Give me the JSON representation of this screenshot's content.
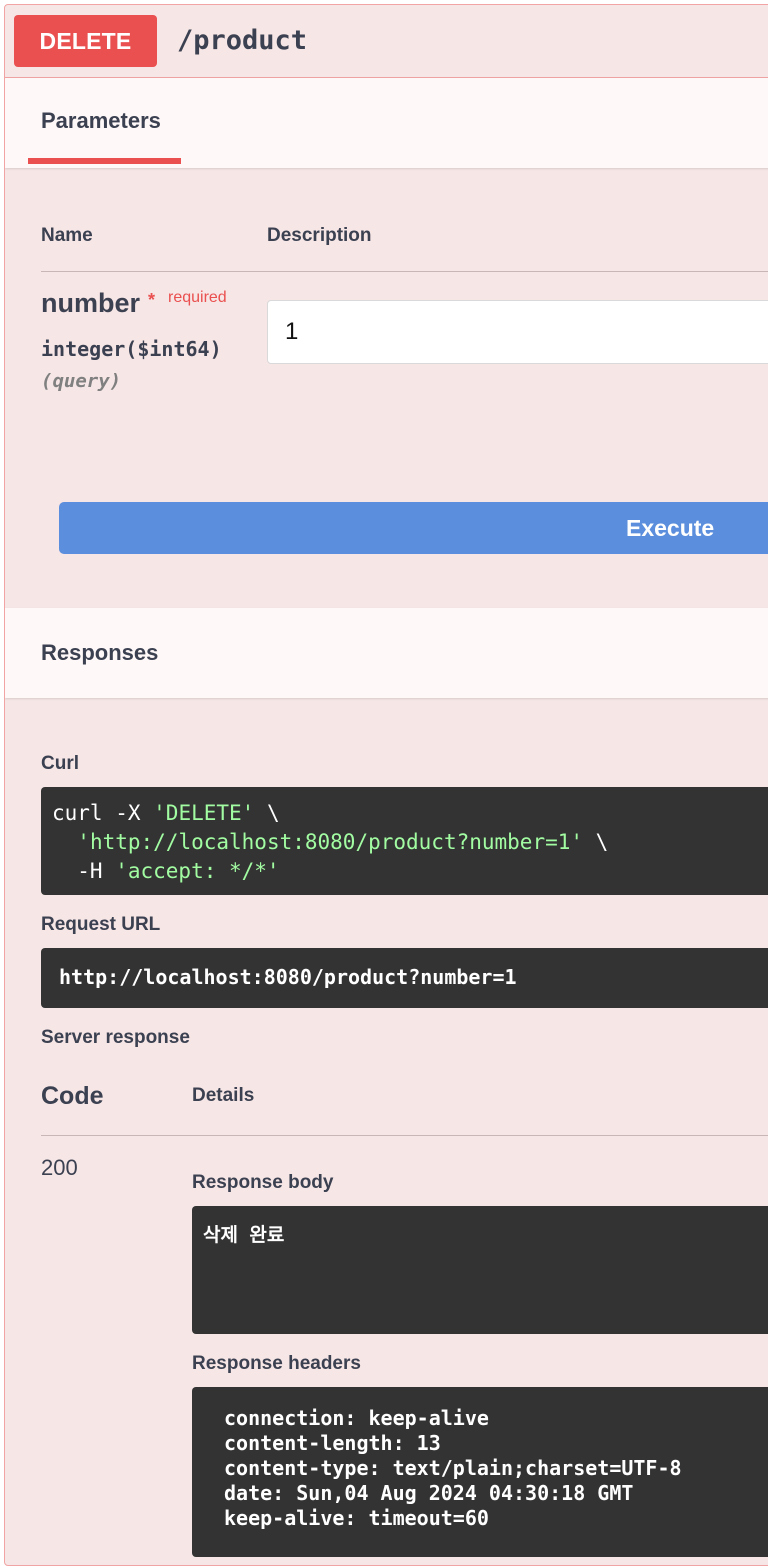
{
  "summary": {
    "method": "DELETE",
    "path": "/product"
  },
  "parameters": {
    "title": "Parameters",
    "col_name": "Name",
    "col_description": "Description",
    "param": {
      "name": "number",
      "required_mark": "*",
      "required_label": "required",
      "type": "integer($int64)",
      "location": "(query)",
      "value": "1"
    },
    "execute_label": "Execute"
  },
  "responses": {
    "title": "Responses",
    "curl_label": "Curl",
    "curl": {
      "line1_cmd": "curl -X ",
      "line1_str": "'DELETE'",
      "line1_end": " \\",
      "line2_indent": "  ",
      "line2_str": "'http://localhost:8080/product?number=1'",
      "line2_end": " \\",
      "line3_cmd": "  -H ",
      "line3_str": "'accept: */*'"
    },
    "request_url_label": "Request URL",
    "request_url": "http://localhost:8080/product?number=1",
    "server_response_label": "Server response",
    "code_header": "Code",
    "details_header": "Details",
    "code": "200",
    "response_body_label": "Response body",
    "response_body": "삭제 완료",
    "response_headers_label": "Response headers",
    "headers": [
      "connection: keep-alive",
      "content-length: 13",
      "content-type: text/plain;charset=UTF-8",
      "date: Sun,04 Aug 2024 04:30:18 GMT",
      "keep-alive: timeout=60"
    ]
  },
  "colors": {
    "method_delete": "#e9504f",
    "block_bg": "#f7e6e6",
    "execute_button": "#5b8edc",
    "code_bg": "#333333",
    "code_string": "#a2fca2"
  }
}
